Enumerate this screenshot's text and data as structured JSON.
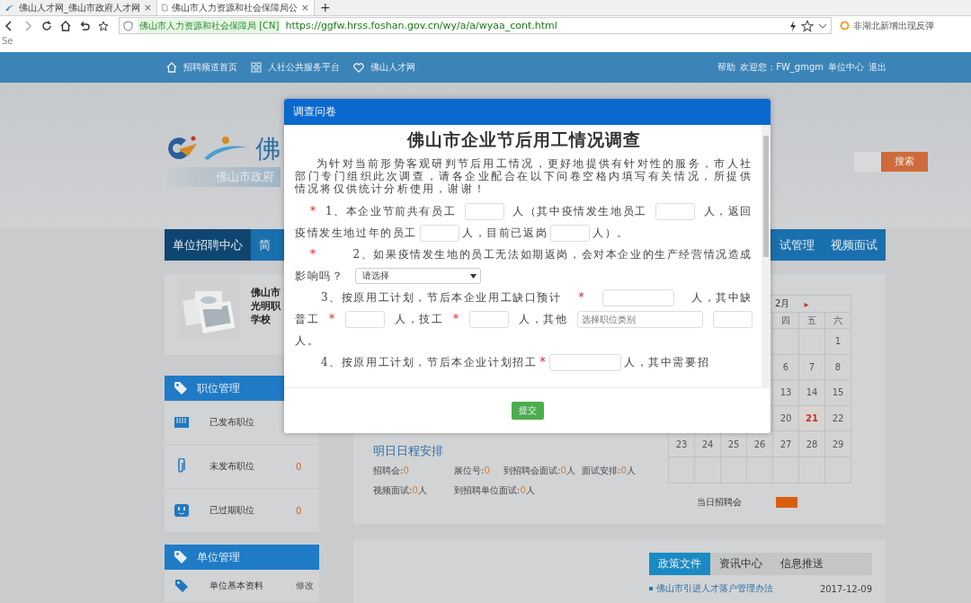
{
  "browser": {
    "tabs": [
      {
        "title": "佛山人才网_佛山市政府人才网",
        "close": "×",
        "selected": false
      },
      {
        "title": "佛山市人力资源和社会保障局公",
        "close": "×",
        "selected": true
      }
    ],
    "new_tab": "+",
    "site_badge": "佛山市人力资源和社会保障局 [CN]",
    "url": "https://ggfw.hrss.foshan.gov.cn/wy/a/a/wyaa_cont.html",
    "search": "非湖北新增出现反弹",
    "bookmark": "Se"
  },
  "header": {
    "links": [
      "招聘频道首页",
      "人社公共服务平台",
      "佛山人才网"
    ],
    "help": "帮助",
    "welcome": "欢迎您：FW_gmgm",
    "unit_center": "单位中心",
    "logout": "退出"
  },
  "banner": {
    "logo_text": "佛",
    "logo_subtitle": "佛山市政府",
    "search_button": "搜索"
  },
  "nav": {
    "left": [
      {
        "label": "单位招聘中心",
        "selected": true
      },
      {
        "label": "简",
        "selected": false
      }
    ],
    "right": [
      {
        "label": "试管理",
        "selected": false
      },
      {
        "label": "视频面试",
        "selected": false
      }
    ]
  },
  "profile": {
    "name_lines": [
      "佛山市",
      "光明职",
      "学校"
    ]
  },
  "sidebar": [
    {
      "title": "职位管理",
      "items": [
        {
          "label": "已发布职位"
        },
        {
          "label": "未发布职位",
          "count": "0"
        },
        {
          "label": "已过期职位",
          "count": "0"
        }
      ]
    },
    {
      "title": "单位管理",
      "items": [
        {
          "label": "单位基本资料",
          "action": "修改"
        }
      ]
    }
  ],
  "schedule": {
    "title": "明日日程安排",
    "stats": [
      {
        "label": "招聘会:",
        "value": "0"
      },
      {
        "label": "展位号:",
        "value": "0"
      },
      {
        "label": "到招聘会面试:",
        "value": "0",
        "unit": "人"
      },
      {
        "label": "面试安排:",
        "value": "0",
        "unit": "人"
      },
      {
        "label": "视频面试:",
        "value": "0",
        "unit": "人"
      },
      {
        "label": "到招聘单位面试:",
        "value": "0",
        "unit": "人"
      }
    ]
  },
  "calendar": {
    "month": "2月",
    "next": "▸",
    "weekdays": [
      "四",
      "五",
      "六"
    ],
    "weeks": [
      [
        {
          "day": "1",
          "today": false
        }
      ],
      [
        {
          "day": "6",
          "today": false
        },
        {
          "day": "7",
          "today": false
        },
        {
          "day": "8",
          "today": false
        }
      ],
      [
        {
          "day": "13",
          "today": false
        },
        {
          "day": "14",
          "today": false
        },
        {
          "day": "15",
          "today": false
        }
      ],
      [
        {
          "day": "20",
          "today": false
        },
        {
          "day": "21",
          "today": true
        },
        {
          "day": "22",
          "today": false
        }
      ],
      [
        {
          "day": "23",
          "today": false
        },
        {
          "day": "24",
          "today": false
        },
        {
          "day": "25",
          "today": false
        },
        {
          "day": "26",
          "today": false
        },
        {
          "day": "27",
          "today": false
        },
        {
          "day": "28",
          "today": false
        },
        {
          "day": "29",
          "today": false
        }
      ]
    ],
    "legend": {
      "label": "当日招聘会",
      "color": "#d95f0e"
    }
  },
  "news": {
    "tabs": [
      {
        "label": "政策文件",
        "selected": true
      },
      {
        "label": "资讯中心",
        "selected": false
      },
      {
        "label": "信息推送",
        "selected": false
      }
    ],
    "items": [
      {
        "title": "佛山市引进人才落户管理办法",
        "date": "2017-12-09"
      }
    ]
  },
  "modal": {
    "title": "调查问卷",
    "heading": "佛山市企业节后用工情况调查",
    "intro": "为针对当前形势客观研判节后用工情况，更好地提供有针对性的服务，市人社部门专门组织此次调查，请各企业配合在以下问卷空格内填写有关情况，所提供情况将仅供统计分析使用，谢谢！",
    "questions": [
      {
        "lines": [
          [
            {
              "kind": "mark",
              "text": "*"
            },
            {
              "kind": "text",
              "text": "1、本企业节前共有员工"
            },
            {
              "kind": "input"
            },
            {
              "kind": "text",
              "text": "人（其中疫情发生地员工"
            },
            {
              "kind": "input"
            },
            {
              "kind": "text",
              "text": "人，返回"
            }
          ],
          [
            {
              "kind": "text",
              "text": "疫情发生地过年的员工"
            },
            {
              "kind": "input"
            },
            {
              "kind": "text",
              "text": "人，目前已返岗"
            },
            {
              "kind": "input"
            },
            {
              "kind": "text",
              "text": "人）。"
            }
          ]
        ]
      },
      {
        "lines": [
          [
            {
              "kind": "mark",
              "text": "*"
            },
            {
              "kind": "text",
              "text": "2、如果疫情发生地的员工无法如期返岗，会对本企业的生产经营情况造成"
            }
          ],
          [
            {
              "kind": "text",
              "text": "影响吗？"
            },
            {
              "kind": "select",
              "text": "请选择"
            }
          ]
        ]
      },
      {
        "lines": [
          [
            {
              "kind": "text",
              "text": "3、按原用工计划，节后本企业用工缺口预计"
            },
            {
              "kind": "mark",
              "text": "*"
            },
            {
              "kind": "wide_input"
            },
            {
              "kind": "text",
              "text": "人，其中缺"
            }
          ],
          [
            {
              "kind": "text",
              "text": "普工"
            },
            {
              "kind": "mark",
              "text": "*"
            },
            {
              "kind": "input"
            },
            {
              "kind": "text",
              "text": "人，技工"
            },
            {
              "kind": "mark",
              "text": "*"
            },
            {
              "kind": "input"
            },
            {
              "kind": "text",
              "text": "人，其他"
            },
            {
              "kind": "picker",
              "placeholder": "选择职位类别"
            },
            {
              "kind": "input"
            }
          ],
          [
            {
              "kind": "text",
              "text": "人。"
            }
          ]
        ]
      },
      {
        "lines": [
          [
            {
              "kind": "text",
              "text": "4、按原用工计划，节后本企业计划招工"
            },
            {
              "kind": "mark",
              "text": "*"
            },
            {
              "kind": "wide_input"
            },
            {
              "kind": "text",
              "text": "人，其中需要招"
            }
          ]
        ]
      }
    ],
    "submit": "提交"
  }
}
